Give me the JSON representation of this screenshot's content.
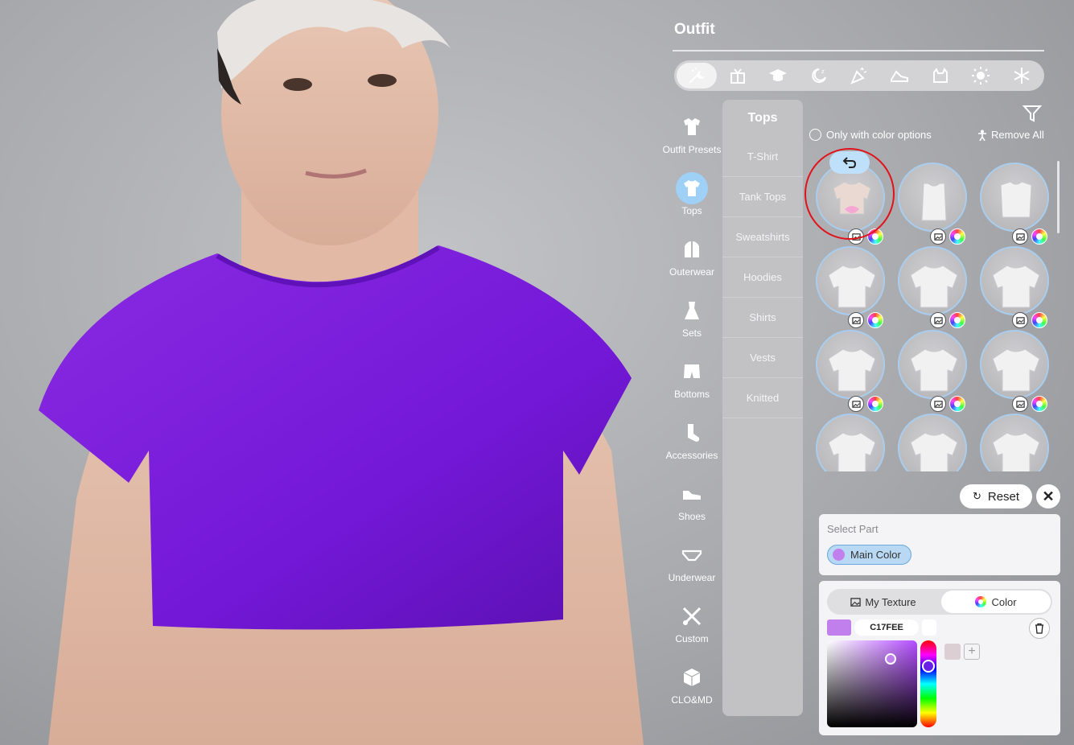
{
  "panel": {
    "title": "Outfit"
  },
  "category_bar": [
    {
      "icon": "magic-wand-moon-icon",
      "active": true
    },
    {
      "icon": "gift-icon",
      "active": false
    },
    {
      "icon": "graduation-cap-icon",
      "active": false
    },
    {
      "icon": "sleep-moon-icon",
      "active": false
    },
    {
      "icon": "party-popper-icon",
      "active": false
    },
    {
      "icon": "sneaker-icon",
      "active": false
    },
    {
      "icon": "cat-icon",
      "active": false
    },
    {
      "icon": "sun-icon",
      "active": false
    },
    {
      "icon": "snowflake-icon",
      "active": false
    }
  ],
  "side_nav": [
    {
      "label": "Outfit Presets",
      "icon": "outfit-presets-icon",
      "active": false
    },
    {
      "label": "Tops",
      "icon": "tshirt-icon",
      "active": true
    },
    {
      "label": "Outerwear",
      "icon": "jacket-icon",
      "active": false
    },
    {
      "label": "Sets",
      "icon": "dress-icon",
      "active": false
    },
    {
      "label": "Bottoms",
      "icon": "shorts-icon",
      "active": false
    },
    {
      "label": "Accessories",
      "icon": "sock-icon",
      "active": false
    },
    {
      "label": "Shoes",
      "icon": "shoe-icon",
      "active": false
    },
    {
      "label": "Underwear",
      "icon": "underwear-icon",
      "active": false
    },
    {
      "label": "Custom",
      "icon": "tools-icon",
      "active": false
    },
    {
      "label": "CLO&MD",
      "icon": "cube-icon",
      "active": false
    }
  ],
  "subcategory": {
    "title": "Tops",
    "items": [
      "T-Shirt",
      "Tank Tops",
      "Sweatshirts",
      "Hoodies",
      "Shirts",
      "Vests",
      "Knitted"
    ]
  },
  "grid": {
    "only_color_label": "Only with color options",
    "remove_all_label": "Remove All"
  },
  "actions": {
    "reset_label": "Reset",
    "close_symbol": "✕"
  },
  "select_part": {
    "label": "Select Part",
    "main_color_label": "Main Color"
  },
  "color_editor": {
    "tab_texture": "My Texture",
    "tab_color": "Color",
    "hex_value": "C17FEE",
    "current_color": "#c17fee"
  },
  "colors": {
    "accent": "#9fd1f7",
    "selection_ring": "#e0121b",
    "shirt": "#7a1fd6"
  }
}
